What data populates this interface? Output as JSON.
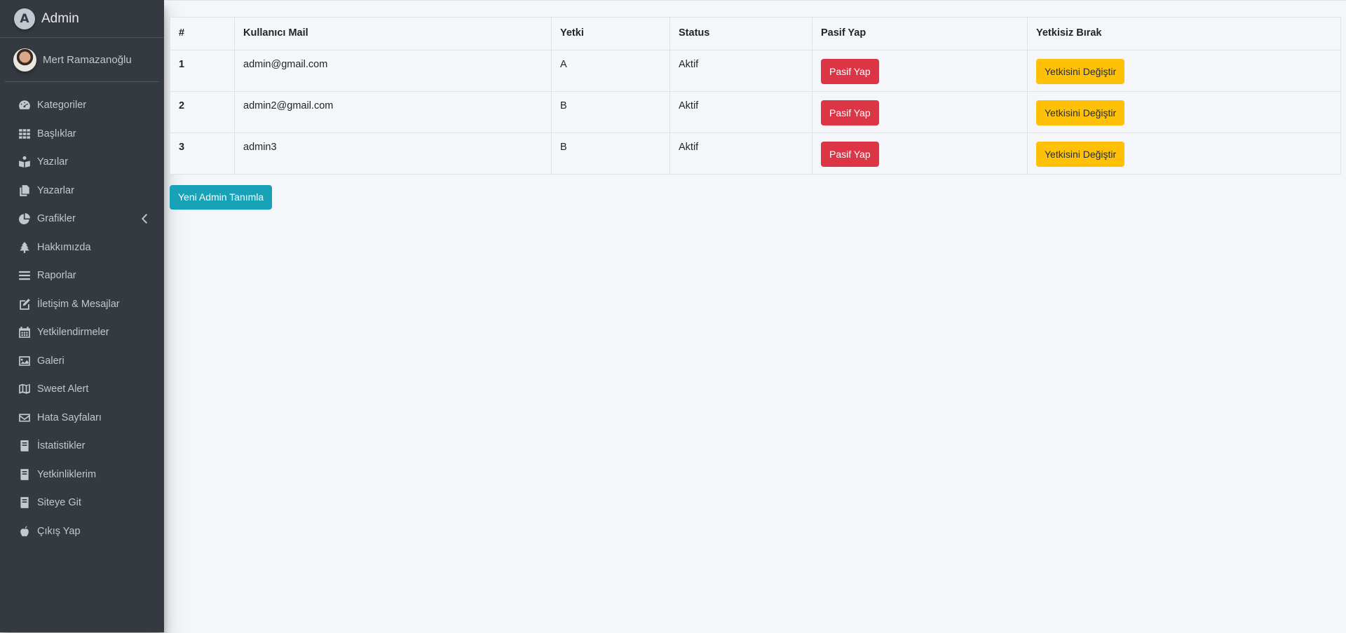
{
  "brand": {
    "logo_letter": "A",
    "title": "Admin"
  },
  "user": {
    "name": "Mert Ramazanoğlu"
  },
  "sidebar": {
    "items": [
      {
        "label": "Kategoriler",
        "icon": "dashboard-icon"
      },
      {
        "label": "Başlıklar",
        "icon": "grid-icon"
      },
      {
        "label": "Yazılar",
        "icon": "book-reader-icon"
      },
      {
        "label": "Yazarlar",
        "icon": "copy-icon"
      },
      {
        "label": "Grafikler",
        "icon": "chart-pie-icon",
        "expandable": true
      },
      {
        "label": "Hakkımızda",
        "icon": "tree-icon"
      },
      {
        "label": "Raporlar",
        "icon": "list-icon"
      },
      {
        "label": "İletişim & Mesajlar",
        "icon": "edit-icon"
      },
      {
        "label": "Yetkilendirmeler",
        "icon": "calendar-icon"
      },
      {
        "label": "Galeri",
        "icon": "image-icon"
      },
      {
        "label": "Sweet Alert",
        "icon": "map-icon"
      },
      {
        "label": "Hata Sayfaları",
        "icon": "envelope-icon"
      },
      {
        "label": "İstatistikler",
        "icon": "book-icon"
      },
      {
        "label": "Yetkinliklerim",
        "icon": "book-icon"
      },
      {
        "label": "Siteye Git",
        "icon": "book-icon"
      },
      {
        "label": "Çıkış Yap",
        "icon": "apple-icon"
      }
    ]
  },
  "table": {
    "headers": [
      "#",
      "Kullanıcı Mail",
      "Yetki",
      "Status",
      "Pasif Yap",
      "Yetkisiz Bırak"
    ],
    "rows": [
      {
        "id": "1",
        "mail": "admin@gmail.com",
        "role": "A",
        "status": "Aktif",
        "passive_label": "Pasif Yap",
        "change_label": "Yetkisini Değiştir"
      },
      {
        "id": "2",
        "mail": "admin2@gmail.com",
        "role": "B",
        "status": "Aktif",
        "passive_label": "Pasif Yap",
        "change_label": "Yetkisini Değiştir"
      },
      {
        "id": "3",
        "mail": "admin3",
        "role": "B",
        "status": "Aktif",
        "passive_label": "Pasif Yap",
        "change_label": "Yetkisini Değiştir"
      }
    ]
  },
  "actions": {
    "new_admin_label": "Yeni Admin Tanımla"
  },
  "colors": {
    "sidebar_bg": "#343a40",
    "sidebar_text": "#c2c7d0",
    "content_bg": "#f4f6f9",
    "danger": "#dc3545",
    "warning": "#ffc107",
    "info": "#17a2b8"
  }
}
